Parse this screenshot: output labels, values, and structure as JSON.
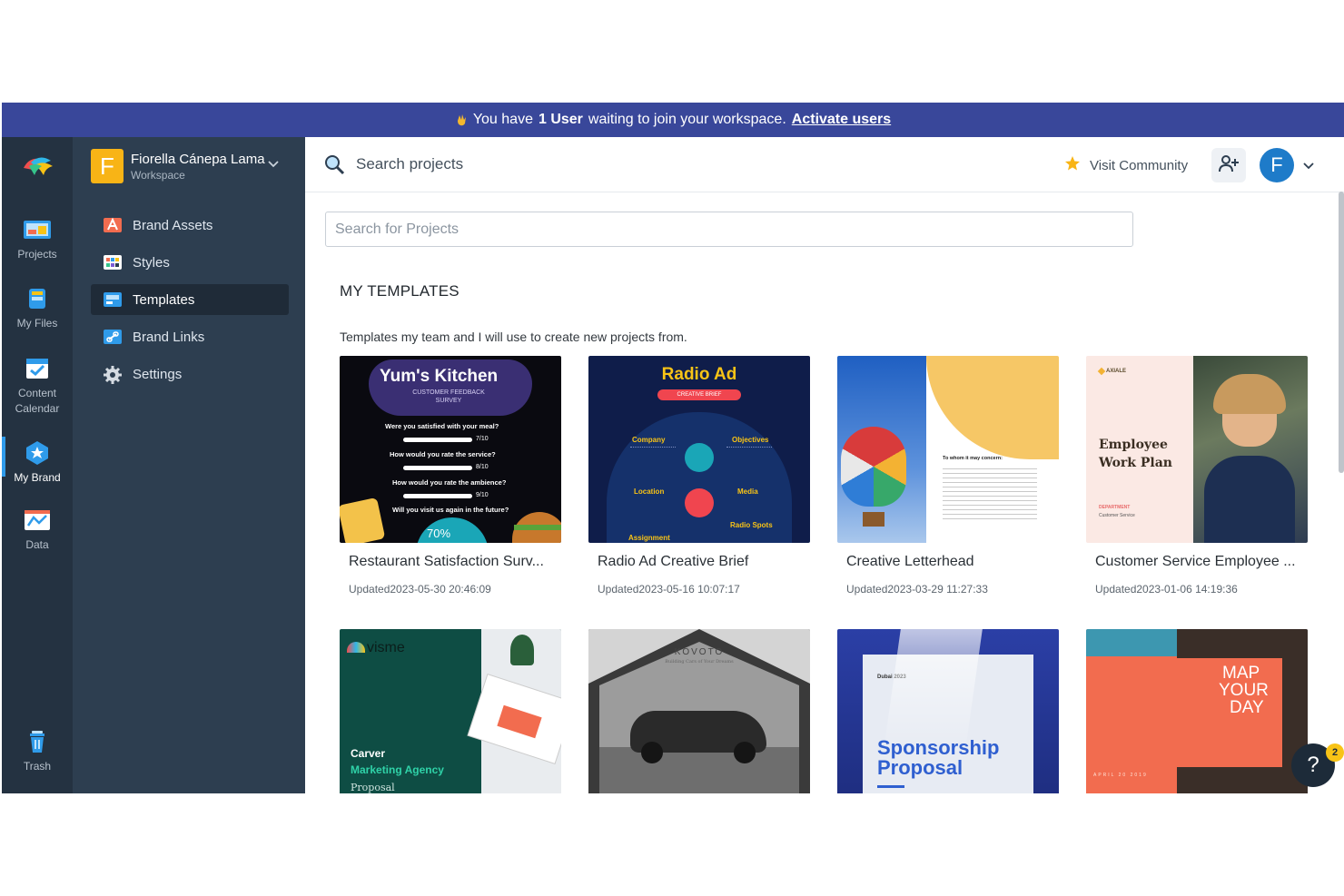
{
  "banner": {
    "prefix": "You have",
    "bold": "1 User",
    "suffix": "waiting to join your workspace.",
    "link": "Activate users"
  },
  "rail": {
    "items": [
      {
        "label": "Projects"
      },
      {
        "label": "My Files"
      },
      {
        "label": "Content Calendar"
      },
      {
        "label": "My Brand"
      },
      {
        "label": "Data"
      }
    ],
    "trash": "Trash"
  },
  "workspace": {
    "initial": "F",
    "name": "Fiorella Cánepa Lama",
    "subtitle": "Workspace"
  },
  "menu": {
    "items": [
      {
        "label": "Brand Assets",
        "icon": "brand-assets-icon"
      },
      {
        "label": "Styles",
        "icon": "styles-icon"
      },
      {
        "label": "Templates",
        "icon": "templates-icon"
      },
      {
        "label": "Brand Links",
        "icon": "brand-links-icon"
      },
      {
        "label": "Settings",
        "icon": "gear-icon"
      }
    ],
    "active": "Templates"
  },
  "topbar": {
    "search_label": "Search projects",
    "community": "Visit Community",
    "avatar_initial": "F"
  },
  "search": {
    "placeholder": "Search for Projects"
  },
  "section": {
    "title": "MY TEMPLATES",
    "description": "Templates my team and I will use to create new projects from."
  },
  "templates": [
    {
      "title": "Restaurant Satisfaction Surv...",
      "updated": "Updated2023-05-30 20:46:09",
      "thumb": {
        "heading": "Yum's Kitchen",
        "sub": "CUSTOMER FEEDBACK SURVEY",
        "q1": "Were you satisfied with your meal?",
        "a1": "7/10",
        "q2": "How would you rate the service?",
        "a2": "8/10",
        "q3": "How would you rate the ambience?",
        "a3": "9/10",
        "q4": "Will you visit us again in the future?",
        "pct": "70%"
      }
    },
    {
      "title": "Radio Ad Creative Brief",
      "updated": "Updated2023-05-16 10:07:17",
      "thumb": {
        "heading": "Radio Ad",
        "pill": "CREATIVE BRIEF",
        "l1": "Company",
        "l2": "Objectives",
        "l3": "Location",
        "l4": "Media",
        "l5": "Radio Spots",
        "l6": "Assignment"
      }
    },
    {
      "title": "Creative Letterhead",
      "updated": "Updated2023-03-29 11:27:33",
      "thumb": {
        "salutation": "To whom it may concern:"
      }
    },
    {
      "title": "Customer Service Employee ...",
      "updated": "Updated2023-01-06 14:19:36",
      "thumb": {
        "brand": "AXIALE",
        "heading": "Employee Work Plan",
        "dept": "DEPARTMENT",
        "dept_value": "Customer Service"
      }
    },
    {
      "title": "",
      "updated": "",
      "thumb": {
        "brand": "visme",
        "l1": "Carver",
        "l2": "Marketing Agency",
        "l3": "Proposal"
      }
    },
    {
      "title": "",
      "updated": "",
      "thumb": {
        "brand": "KOVOTO",
        "tagline": "Building Cars of Your Dreams"
      }
    },
    {
      "title": "",
      "updated": "",
      "thumb": {
        "small": "Dubai 2023",
        "heading1": "Sponsorship",
        "heading2": "Proposal"
      }
    },
    {
      "title": "",
      "updated": "",
      "thumb": {
        "l1": "MAP",
        "l2": "YOUR",
        "l3": "DAY",
        "date": "APRIL 20 2019"
      }
    }
  ],
  "help": {
    "label": "?",
    "badge": "2"
  },
  "colors": {
    "banner": "#39479a",
    "rail": "#243241",
    "panel": "#2d3e50",
    "accent": "#1e7bc9",
    "workspace_avatar": "#f8b416"
  }
}
